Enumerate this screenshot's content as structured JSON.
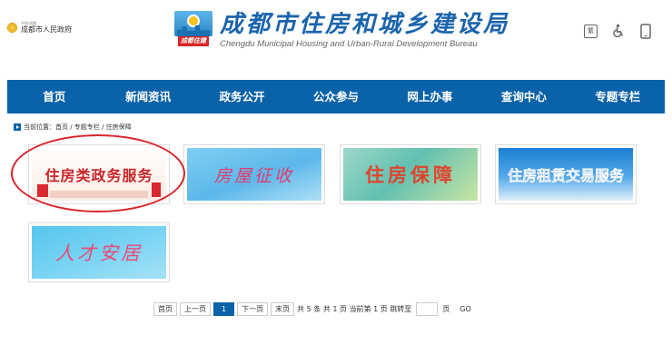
{
  "header": {
    "gov_small_text": "中国·成都",
    "gov_name": "成都市人民政府",
    "brand_tag": "成都住建",
    "brand_title": "成都市住房和城乡建设局",
    "brand_subtitle": "Chengdu Municipal Housing and Urban-Rural Development Bureau",
    "tools": [
      {
        "icon": "traditional-chinese-icon",
        "label": "繁"
      },
      {
        "icon": "accessibility-icon"
      },
      {
        "icon": "mobile-icon"
      }
    ]
  },
  "nav": {
    "items": [
      "首页",
      "新闻资讯",
      "政务公开",
      "公众参与",
      "网上办事",
      "查询中心",
      "专题专栏"
    ]
  },
  "breadcrumb": {
    "text": "当前位置：首页 / 专题专栏 / 住房保障"
  },
  "cards": [
    {
      "label": "住房类政务服务",
      "highlighted": true
    },
    {
      "label": "房屋征收"
    },
    {
      "label": "住房保障"
    },
    {
      "label": "住房租赁交易服务"
    },
    {
      "label": "人才安居"
    }
  ],
  "pagination": {
    "first": "首页",
    "prev": "上一页",
    "current": "1",
    "next": "下一页",
    "last": "末页",
    "summary": "共 5 条 共 1 页 当前第 1 页 跳转至",
    "page_unit": "页",
    "go": "GO"
  },
  "colors": {
    "nav_bg": "#0a62a9",
    "brand_blue": "#1a64ad",
    "highlight_red": "#d8262d"
  }
}
